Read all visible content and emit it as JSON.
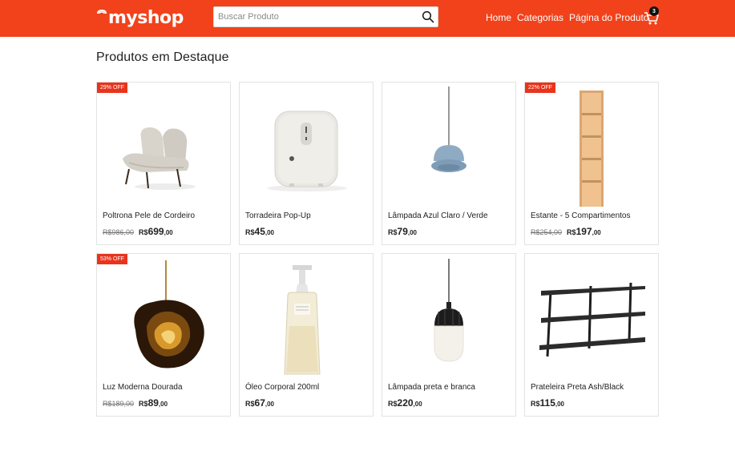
{
  "header": {
    "logo_text": "myshop",
    "search_placeholder": "Buscar Produto",
    "nav": [
      "Home",
      "Categorias",
      "Página do Produto"
    ],
    "cart_count": "3",
    "brand_color": "#f2421b"
  },
  "section_title": "Produtos em Destaque",
  "products": [
    {
      "badge": "29% OFF",
      "name": "Poltrona Pele de Cordeiro",
      "old_price": "R$986,00",
      "currency": "R$",
      "price_int": "699",
      "price_cents": ",00",
      "icon": "armchair-image"
    },
    {
      "badge": "",
      "name": "Torradeira Pop-Up",
      "old_price": "",
      "currency": "R$",
      "price_int": "45",
      "price_cents": ",00",
      "icon": "toaster-image"
    },
    {
      "badge": "",
      "name": "Lâmpada Azul Claro / Verde",
      "old_price": "",
      "currency": "R$",
      "price_int": "79",
      "price_cents": ",00",
      "icon": "blue-pendant-lamp-image"
    },
    {
      "badge": "22% OFF",
      "name": "Estante - 5 Compartimentos",
      "old_price": "R$254,00",
      "currency": "R$",
      "price_int": "197",
      "price_cents": ",00",
      "icon": "bookshelf-image"
    },
    {
      "badge": "53% OFF",
      "name": "Luz Moderna Dourada",
      "old_price": "R$189,00",
      "currency": "R$",
      "price_int": "89",
      "price_cents": ",00",
      "icon": "gold-pendant-light-image"
    },
    {
      "badge": "",
      "name": "Óleo Corporal 200ml",
      "old_price": "",
      "currency": "R$",
      "price_int": "67",
      "price_cents": ",00",
      "icon": "oil-bottle-image"
    },
    {
      "badge": "",
      "name": "Lâmpada preta e branca",
      "old_price": "",
      "currency": "R$",
      "price_int": "220",
      "price_cents": ",00",
      "icon": "black-white-lamp-image"
    },
    {
      "badge": "",
      "name": "Prateleira Preta Ash/Black",
      "old_price": "",
      "currency": "R$",
      "price_int": "115",
      "price_cents": ",00",
      "icon": "wall-shelf-image"
    }
  ]
}
